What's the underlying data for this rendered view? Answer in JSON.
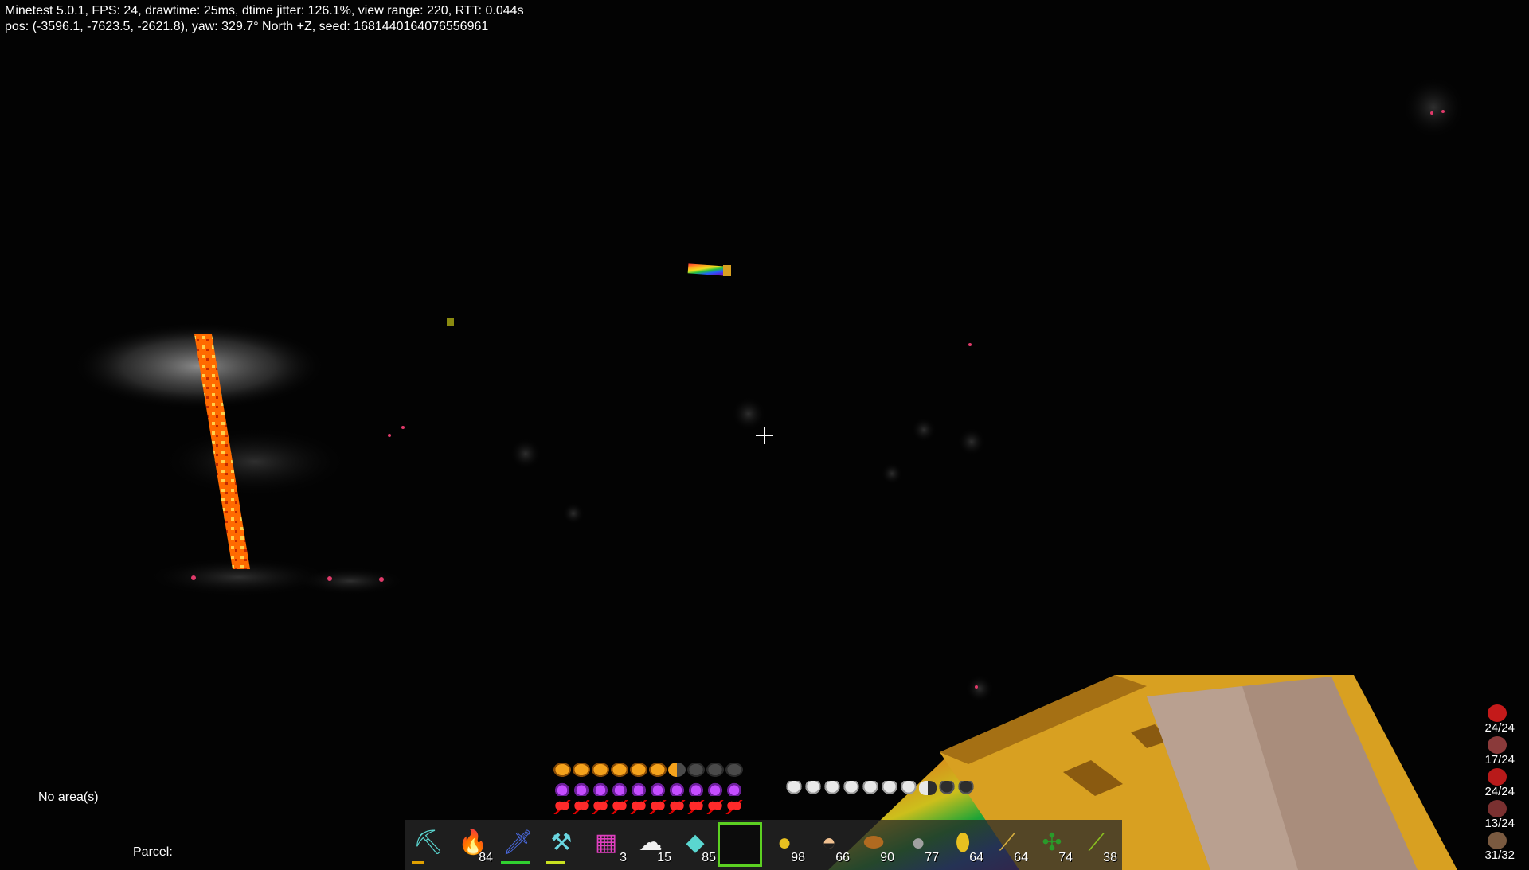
{
  "debug": {
    "line1": "Minetest 5.0.1, FPS: 24, drawtime: 25ms, dtime jitter: 126.1%, view range: 220, RTT: 0.044s",
    "line2": "pos: (-3596.1, -7623.5, -2621.8), yaw: 329.7° North +Z, seed: 1681440164076556961"
  },
  "hud": {
    "area": "No area(s)",
    "parcel": "Parcel:"
  },
  "bars": {
    "hunger": {
      "filled": 6,
      "half": 1,
      "total": 10
    },
    "mana": {
      "filled": 10,
      "total": 10
    },
    "health": {
      "filled": 10,
      "total": 10
    },
    "armor": {
      "filled": 7,
      "half": 1,
      "total": 10
    }
  },
  "hotbar": {
    "slots": [
      {
        "icon": "diamond-pickaxe-icon",
        "glyph": "⛏",
        "count": "",
        "wear_color": "#e0a000",
        "wear": 0.4
      },
      {
        "icon": "torch-icon",
        "glyph": "🔥",
        "count": "84"
      },
      {
        "icon": "diamond-sword-icon",
        "glyph": "🗡",
        "count": "",
        "wear_color": "#30d030",
        "wear": 0.9
      },
      {
        "icon": "diamond-shovel-icon",
        "glyph": "⚒",
        "count": "",
        "wear_color": "#c8e020",
        "wear": 0.6
      },
      {
        "icon": "rainbow-block-icon",
        "glyph": "▦",
        "count": "3"
      },
      {
        "icon": "cotton-icon",
        "glyph": "☁",
        "count": "15"
      },
      {
        "icon": "diamond-icon",
        "glyph": "◆",
        "count": "85"
      },
      {
        "icon": "empty-slot",
        "glyph": "",
        "count": "",
        "selected": true
      },
      {
        "icon": "gold-lump-icon",
        "glyph": "●",
        "count": "98"
      },
      {
        "icon": "cake-icon",
        "glyph": "◓",
        "count": "66"
      },
      {
        "icon": "bread-icon",
        "glyph": "⬬",
        "count": "90"
      },
      {
        "icon": "iron-lump-icon",
        "glyph": "●",
        "count": "77"
      },
      {
        "icon": "corn-icon",
        "glyph": "⬮",
        "count": "64"
      },
      {
        "icon": "baguette-icon",
        "glyph": "⟋",
        "count": "64"
      },
      {
        "icon": "cactus-icon",
        "glyph": "✣",
        "count": "74"
      },
      {
        "icon": "stick-icon",
        "glyph": "⟋",
        "count": "38"
      }
    ]
  },
  "side_stats": [
    {
      "icon": "health-heart-icon",
      "text": "24/24",
      "color": "#c41a1a"
    },
    {
      "icon": "stamina-icon",
      "text": "17/24",
      "color": "#8a3a3a"
    },
    {
      "icon": "hunger-heart-icon",
      "text": "24/24",
      "color": "#b81a1a"
    },
    {
      "icon": "thirst-icon",
      "text": "13/24",
      "color": "#7a3030"
    },
    {
      "icon": "backpack-icon",
      "text": "31/32",
      "color": "#7a5a40"
    }
  ],
  "colors": {
    "lava": "#ff7a10",
    "gold_block": "#d8a021",
    "hand": "#a98d7c",
    "hotbar_selected": "#5cd022"
  }
}
